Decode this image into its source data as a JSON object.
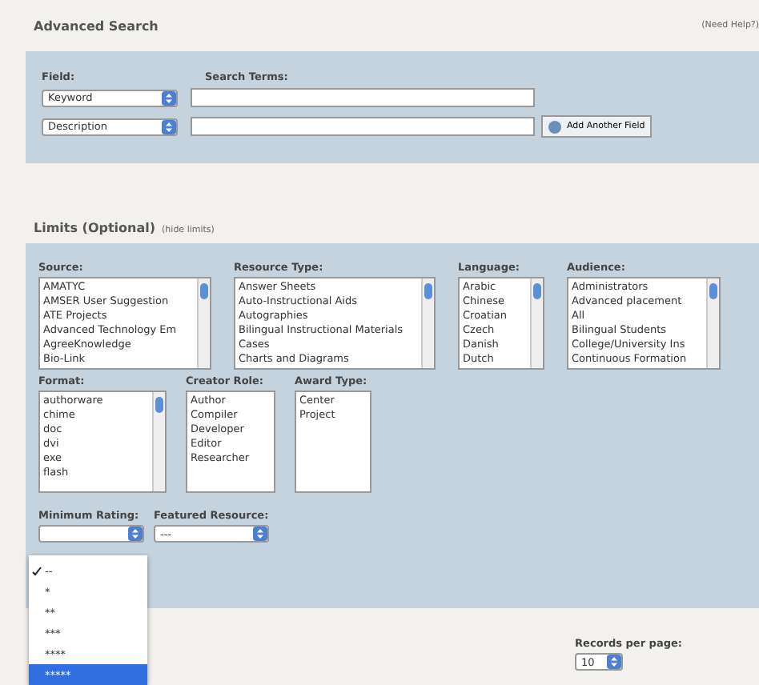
{
  "header": {
    "title": "Advanced Search",
    "help_link": "(Need Help?)"
  },
  "search": {
    "field_label": "Field:",
    "terms_label": "Search Terms:",
    "rows": [
      {
        "field": "Keyword"
      },
      {
        "field": "Description"
      }
    ],
    "add_button": "Add Another Field"
  },
  "limits": {
    "title": "Limits (Optional)",
    "hide_link": "(hide limits)",
    "lists": [
      {
        "label": "Source:",
        "kind": "scrolling",
        "items": [
          "AMATYC",
          "AMSER User Suggestion",
          "ATE Projects",
          "Advanced Technology Em",
          "AgreeKnowledge",
          "Bio-Link"
        ]
      },
      {
        "label": "Resource Type:",
        "kind": "scrolling",
        "items": [
          "Answer Sheets",
          "Auto-Instructional Aids",
          "Autographies",
          "Bilingual Instructional Materials",
          "Cases",
          "Charts and Diagrams"
        ]
      },
      {
        "label": "Language:",
        "kind": "scrolling",
        "items": [
          "Arabic",
          "Chinese",
          "Croatian",
          "Czech",
          "Danish",
          "Dutch"
        ]
      },
      {
        "label": "Audience:",
        "kind": "scrolling",
        "items": [
          "Administrators",
          "Advanced placement",
          "All",
          "Bilingual Students",
          "College/University Ins",
          "Continuous Formation"
        ]
      },
      {
        "label": "Format:",
        "kind": "scrolling",
        "items": [
          "authorware",
          "chime",
          "doc",
          "dvi",
          "exe",
          "flash"
        ]
      },
      {
        "label": "Creator Role:",
        "kind": "plain",
        "items": [
          "Author",
          "Compiler",
          "Developer",
          "Editor",
          "Researcher"
        ]
      },
      {
        "label": "Award Type:",
        "kind": "plain",
        "items": [
          "Center",
          "Project"
        ]
      }
    ],
    "rating_label": "Minimum Rating:",
    "featured_label": "Featured Resource:",
    "featured_value": "---",
    "rating_menu": [
      {
        "label": "--",
        "checked": true,
        "selected": false
      },
      {
        "label": "*",
        "checked": false,
        "selected": false
      },
      {
        "label": "**",
        "checked": false,
        "selected": false
      },
      {
        "label": "***",
        "checked": false,
        "selected": false
      },
      {
        "label": "****",
        "checked": false,
        "selected": false
      },
      {
        "label": "*****",
        "checked": false,
        "selected": true
      }
    ]
  },
  "records": {
    "label": "Records per page:",
    "value": "10"
  }
}
